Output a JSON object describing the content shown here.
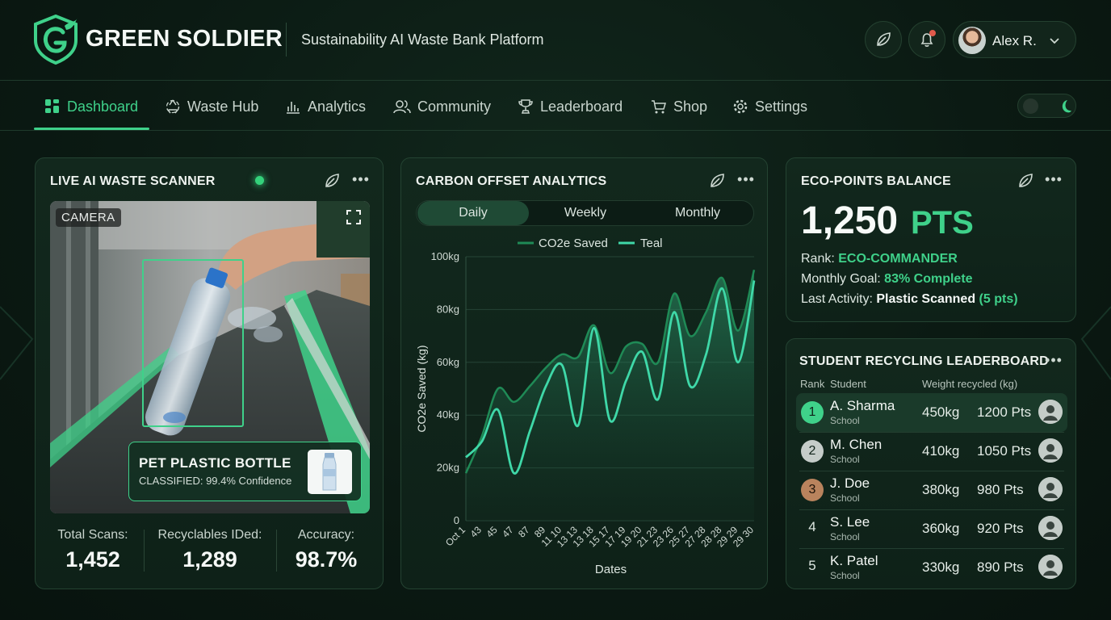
{
  "header": {
    "brand": "GREEN SOLDIER",
    "tagline": "Sustainability AI Waste Bank Platform",
    "user_name": "Alex R."
  },
  "nav": {
    "items": [
      {
        "label": "Dashboard",
        "icon": "grid-icon"
      },
      {
        "label": "Waste Hub",
        "icon": "recycle-icon"
      },
      {
        "label": "Analytics",
        "icon": "bar-chart-icon"
      },
      {
        "label": "Community",
        "icon": "users-icon"
      },
      {
        "label": "Leaderboard",
        "icon": "trophy-icon"
      },
      {
        "label": "Shop",
        "icon": "cart-icon"
      },
      {
        "label": "Settings",
        "icon": "gear-icon"
      }
    ],
    "active": "Dashboard"
  },
  "scanner": {
    "title": "LIVE AI WASTE SCANNER",
    "camera_label": "CAMERA",
    "classification_title": "PET PLASTIC BOTTLE",
    "classification_sub": "CLASSIFIED: 99.4% Confidence",
    "stats": [
      {
        "label": "Total Scans:",
        "value": "1,452"
      },
      {
        "label": "Recyclables IDed:",
        "value": "1,289"
      },
      {
        "label": "Accuracy:",
        "value": "98.7%"
      }
    ]
  },
  "carbon": {
    "title": "CARBON OFFSET ANALYTICS",
    "tabs": [
      "Daily",
      "Weekly",
      "Monthly"
    ],
    "active_tab": "Daily"
  },
  "chart_data": {
    "type": "line",
    "xlabel": "Dates",
    "ylabel": "CO2e Saved (kg)",
    "ylim": [
      0,
      100
    ],
    "yticks": [
      "0",
      "20kg",
      "40kg",
      "60kg",
      "80kg",
      "100kg"
    ],
    "x": [
      "Oct 1",
      "43",
      "45",
      "47",
      "87",
      "89",
      "11 10",
      "13 13",
      "13 18",
      "15 17",
      "17 19",
      "19 20",
      "21 23",
      "23 26",
      "25 27",
      "27 28",
      "28 28",
      "29 29",
      "29 30"
    ],
    "grid": true,
    "legend_position": "top",
    "series": [
      {
        "name": "CO2e Saved",
        "color": "#1f8a56",
        "values": [
          18,
          32,
          50,
          45,
          51,
          58,
          63,
          62,
          74,
          56,
          66,
          67,
          60,
          86,
          70,
          79,
          92,
          72,
          95
        ]
      },
      {
        "name": "Teal",
        "color": "#3fd8a8",
        "values": [
          24,
          30,
          42,
          18,
          34,
          51,
          59,
          36,
          73,
          38,
          53,
          64,
          46,
          79,
          51,
          63,
          88,
          60,
          91
        ]
      }
    ]
  },
  "points": {
    "title": "ECO-POINTS BALANCE",
    "value": "1,250",
    "unit": "PTS",
    "rank_label": "Rank:",
    "rank_value": "ECO-COMMANDER",
    "goal_label": "Monthly Goal:",
    "goal_value": "83% Complete",
    "activity_label": "Last Activity:",
    "activity_value": "Plastic Scanned",
    "activity_points": "(5 pts)"
  },
  "leaderboard": {
    "title": "STUDENT RECYCLING LEADERBOARD",
    "headers": {
      "rank": "Rank",
      "student": "Student",
      "weight": "Weight recycled (kg)"
    },
    "rows": [
      {
        "rank": "1",
        "name": "A. Sharma",
        "school": "School",
        "weight": "450kg",
        "points": "1200 Pts",
        "badge_color": "#3fd18a"
      },
      {
        "rank": "2",
        "name": "M. Chen",
        "school": "School",
        "weight": "410kg",
        "points": "1050 Pts",
        "badge_color": "#c5ccc9"
      },
      {
        "rank": "3",
        "name": "J. Doe",
        "school": "School",
        "weight": "380kg",
        "points": "980 Pts",
        "badge_color": "#b9835d"
      },
      {
        "rank": "4",
        "name": "S. Lee",
        "school": "School",
        "weight": "360kg",
        "points": "920 Pts",
        "badge_color": ""
      },
      {
        "rank": "5",
        "name": "K. Patel",
        "school": "School",
        "weight": "330kg",
        "points": "890 Pts",
        "badge_color": ""
      }
    ]
  }
}
